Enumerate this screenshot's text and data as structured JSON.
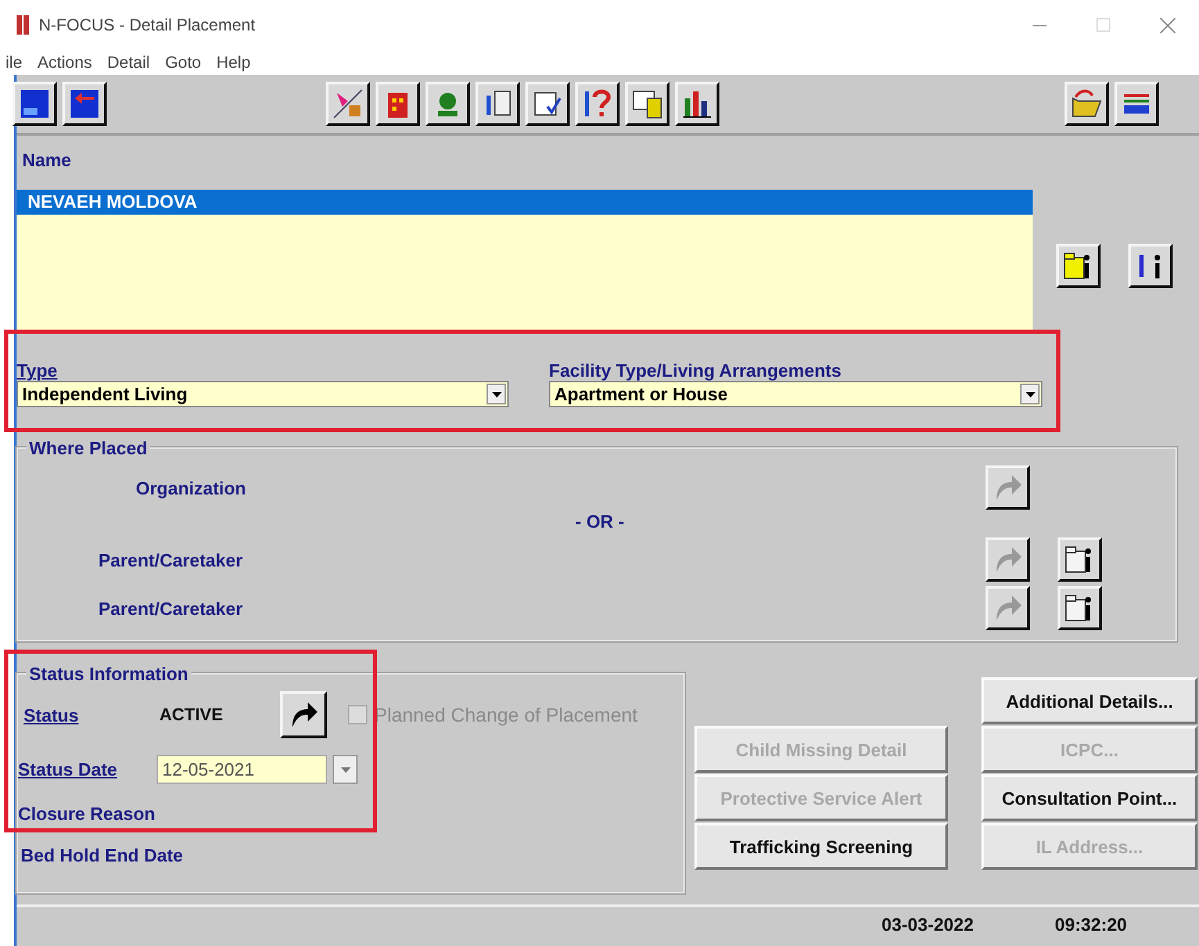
{
  "window": {
    "title": "N-FOCUS - Detail Placement"
  },
  "menu": [
    "ile",
    "Actions",
    "Detail",
    "Goto",
    "Help"
  ],
  "name_section": {
    "label": "Name",
    "rows": [
      {
        "text": "NEVAEH MOLDOVA",
        "selected": true
      }
    ]
  },
  "placement_type": {
    "highlighted": true,
    "type": {
      "label": "Type",
      "value": "Independent Living"
    },
    "facility": {
      "label": "Facility Type/Living Arrangements",
      "value": "Apartment or House"
    }
  },
  "where_placed": {
    "title": "Where Placed",
    "organization": "Organization",
    "or_text": "- OR -",
    "caretakers": [
      "Parent/Caretaker",
      "Parent/Caretaker"
    ]
  },
  "status_info": {
    "highlighted": true,
    "title": "Status Information",
    "status_label": "Status",
    "status_value": "ACTIVE",
    "planned_change": {
      "label": "Planned Change of Placement",
      "checked": false,
      "disabled": true
    },
    "status_date": {
      "label": "Status Date",
      "value": "12-05-2021"
    },
    "closure_reason": "Closure Reason",
    "bed_hold": "Bed Hold End Date"
  },
  "buttons_left": [
    {
      "label": "Child Missing Detail",
      "disabled": true
    },
    {
      "label": "Protective Service Alert",
      "disabled": true
    },
    {
      "label": "Trafficking Screening",
      "disabled": false
    }
  ],
  "buttons_right": [
    {
      "label": "Additional Details...",
      "disabled": false
    },
    {
      "label": "ICPC...",
      "disabled": true
    },
    {
      "label": "Consultation Point...",
      "disabled": false
    },
    {
      "label": "IL Address...",
      "disabled": true
    }
  ],
  "status_bar": {
    "date": "03-03-2022",
    "time": "09:32:20"
  }
}
